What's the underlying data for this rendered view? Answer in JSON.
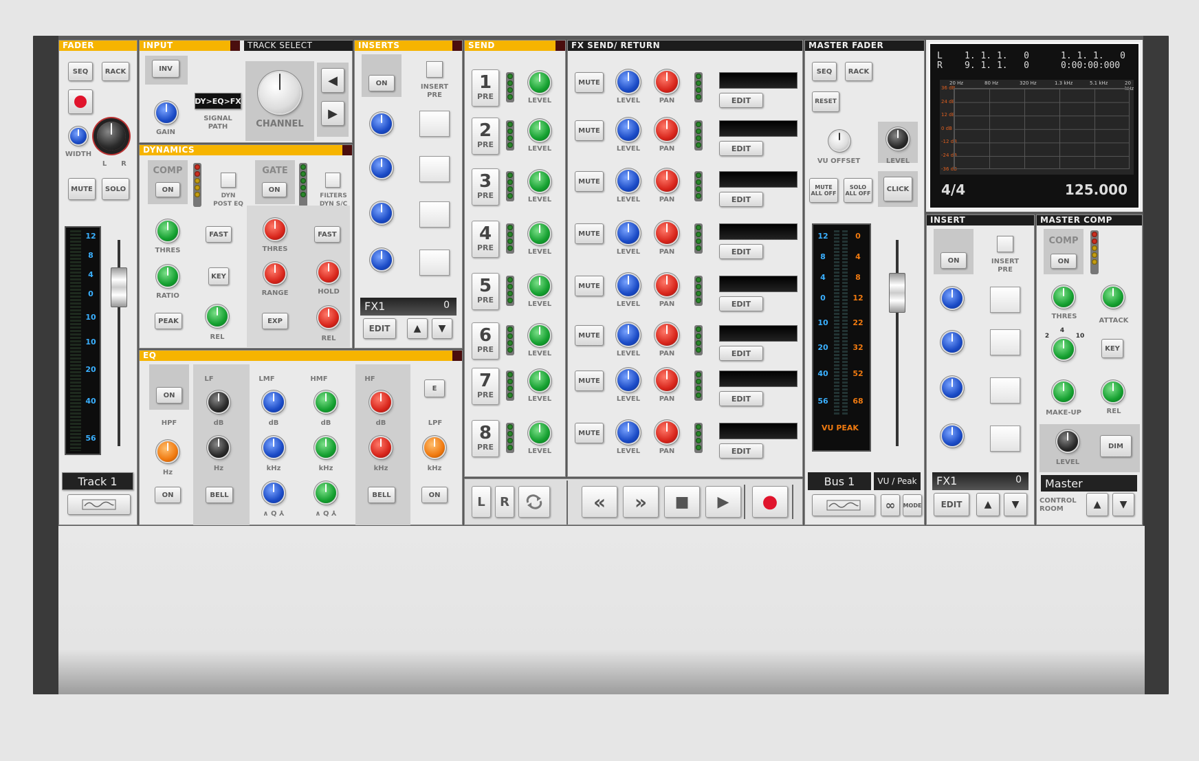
{
  "fader": {
    "title": "FADER",
    "seq": "SEQ",
    "rack": "RACK",
    "width": "WIDTH",
    "l": "L",
    "r": "R",
    "mute": "MUTE",
    "solo": "SOLO",
    "scale": [
      "12",
      "8",
      "4",
      "0",
      "10",
      "20",
      "40",
      "56"
    ],
    "track_name": "Track 1"
  },
  "input": {
    "title": "INPUT",
    "inv": "INV",
    "gain": "GAIN",
    "signal_path_value": "DY>EQ>FX",
    "signal_path": "SIGNAL PATH",
    "track_select": "TRACK SELECT",
    "channel": "CHANNEL"
  },
  "dynamics": {
    "title": "DYNAMICS",
    "comp": "COMP",
    "on": "ON",
    "dyn_post_eq": "DYN POST EQ",
    "gate": "GATE",
    "filters_dyn_sc": "FILTERS DYN S/C",
    "thres": "THRES",
    "fast": "FAST",
    "ratio": "RATIO",
    "key": "KEY",
    "range": "RANGE",
    "hold": "HOLD",
    "peak": "PEAK",
    "rel": "REL",
    "exp": "EXP"
  },
  "eq": {
    "title": "EQ",
    "on": "ON",
    "hpf": "HPF",
    "lpf": "LPF",
    "e": "E",
    "lf": "LF",
    "lmf": "LMF",
    "hmf": "HMF",
    "hf": "HF",
    "db": "dB",
    "hz": "Hz",
    "khz": "kHz",
    "q": "∧ Q ⅄",
    "bell": "BELL"
  },
  "inserts": {
    "title": "INSERTS",
    "on": "ON",
    "insert_pre": "INSERT PRE",
    "fx_name": "FX1",
    "fx_value": "0",
    "edit": "EDIT"
  },
  "send": {
    "title": "SEND",
    "pre": "PRE",
    "level": "LEVEL",
    "numbers": [
      "1",
      "2",
      "3",
      "4",
      "5",
      "6",
      "7",
      "8"
    ]
  },
  "fx_send_return": {
    "title": "FX SEND/ RETURN",
    "mute": "MUTE",
    "level": "LEVEL",
    "pan": "PAN",
    "edit": "EDIT"
  },
  "transport": {
    "l": "L",
    "r": "R",
    "loop_icon": "loop-icon",
    "rewind": "«",
    "forward": "»",
    "stop": "■",
    "play": "▶",
    "record": "●"
  },
  "master_fader": {
    "title": "MASTER FADER",
    "seq": "SEQ",
    "rack": "RACK",
    "reset": "RESET",
    "vu_offset": "VU OFFSET",
    "level": "LEVEL",
    "mute_all_off": "MUTE ALL OFF",
    "solo_all_off": "SOLO ALL OFF",
    "click": "CLICK",
    "scale_left": [
      "12",
      "8",
      "4",
      "0",
      "10",
      "20",
      "40",
      "56"
    ],
    "scale_right": [
      "0",
      "4",
      "8",
      "12",
      "22",
      "32",
      "52",
      "68"
    ],
    "vu_peak": "VU PEAK",
    "bus_name": "Bus 1",
    "meter_mode": "VU / Peak",
    "mode": "MODE"
  },
  "display": {
    "l_label": "L",
    "r_label": "R",
    "l_pos": "1. 1. 1.   0",
    "r_pos": "9. 1. 1.   0",
    "song_pos": "1. 1. 1.   0",
    "time": "0:00:00:000",
    "freqs": [
      "20 Hz",
      "80 Hz",
      "320 Hz",
      "1.3 kHz",
      "5.1 kHz",
      "20 kHz"
    ],
    "dbs": [
      "36 dB",
      "24 dB",
      "12 dB",
      "0 dB",
      "-12 dB",
      "-24 dB",
      "-36 dB"
    ],
    "signature": "4/4",
    "tempo": "125.000"
  },
  "master_insert": {
    "title": "INSERT",
    "on": "ON",
    "insert_pre": "INSERT PRE",
    "fx_name": "FX1",
    "fx_value": "0",
    "edit": "EDIT"
  },
  "master_comp": {
    "title": "MASTER COMP",
    "comp": "COMP",
    "on": "ON",
    "thres": "THRES",
    "attack": "ATTACK",
    "ratio_2": "2",
    "ratio_4": "4",
    "ratio_10": "10",
    "key": "KEY",
    "makeup": "MAKE-UP",
    "rel": "REL",
    "level": "LEVEL",
    "dim": "DIM",
    "master_name": "Master",
    "control_room": "CONTROL ROOM"
  },
  "colors": {
    "header_yellow": "#f6b400",
    "panel": "#eaeaea",
    "rack": "#3a3a3a"
  }
}
